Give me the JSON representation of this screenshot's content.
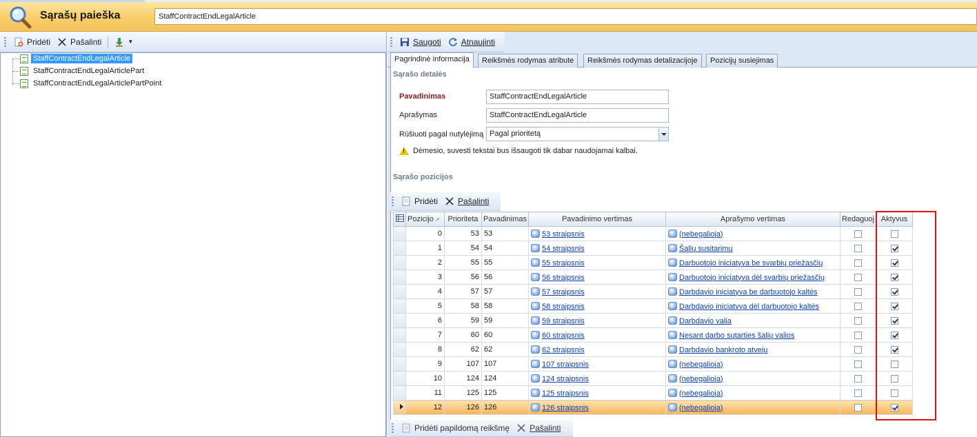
{
  "header": {
    "title": "Sąrašų paieška",
    "search_value": "StaffContractEndLegalArticle"
  },
  "left_toolbar": {
    "add_label": "Pridėti",
    "remove_label": "Pašalinti",
    "import_icon": "download-arrow-icon"
  },
  "tree": {
    "items": [
      {
        "label": "StaffContractEndLegalArticle",
        "selected": true
      },
      {
        "label": "StaffContractEndLegalArticlePart",
        "selected": false
      },
      {
        "label": "StaffContractEndLegalArticlePartPoint",
        "selected": false
      }
    ]
  },
  "right_toolbar": {
    "save_label": "Saugoti",
    "refresh_label": "Atnaujinti"
  },
  "tabs": [
    {
      "label": "Pagrindinė informacija",
      "active": true
    },
    {
      "label": "Reikšmės rodymas atribute",
      "active": false
    },
    {
      "label": "Reikšmės rodymas detalizacijoje",
      "active": false
    },
    {
      "label": "Pozicijų susiejimas",
      "active": false
    }
  ],
  "details": {
    "section_title": "Sąrašo detalės",
    "name_label": "Pavadinimas",
    "name_value": "StaffContractEndLegalArticle",
    "description_label": "Aprašymas",
    "description_value": "StaffContractEndLegalArticle",
    "sort_label": "Rūšiuoti pagal nutylėjimą",
    "sort_value": "Pagal prioritetą",
    "warning": "Dėmesio, suvesti tekstai bus išsaugoti tik dabar naudojamai kalbai."
  },
  "positions": {
    "section_title": "Sąrašo pozicijos",
    "add_label": "Pridėti",
    "remove_label": "Pašalinti",
    "columns": [
      "Pozicijo",
      "Prioriteta",
      "Pavadinimas",
      "Pavadinimo vertimas",
      "Aprašymo vertimas",
      "Redaguoj",
      "Aktyvus"
    ],
    "sort_indicator": "↗",
    "rows": [
      {
        "pos": "0",
        "prio": "53",
        "name": "53",
        "name_tr": "53 straipsnis",
        "desc_tr": "(nebegalioja)",
        "edit": false,
        "active": false
      },
      {
        "pos": "1",
        "prio": "54",
        "name": "54",
        "name_tr": "54 straipsnis",
        "desc_tr": "Šalių susitarimu",
        "edit": false,
        "active": true
      },
      {
        "pos": "2",
        "prio": "55",
        "name": "55",
        "name_tr": "55 straipsnis",
        "desc_tr": "Darbuotojo iniciatyva be svarbių priežasčių",
        "edit": false,
        "active": true
      },
      {
        "pos": "3",
        "prio": "56",
        "name": "56",
        "name_tr": "56 straipsnis",
        "desc_tr": "Darbuotojo iniciatyva dėl svarbių priežasčių",
        "edit": false,
        "active": true
      },
      {
        "pos": "4",
        "prio": "57",
        "name": "57",
        "name_tr": "57 straipsnis",
        "desc_tr": "Darbdavio iniciatyva be darbuotojo kaltės",
        "edit": false,
        "active": true
      },
      {
        "pos": "5",
        "prio": "58",
        "name": "58",
        "name_tr": "58 straipsnis",
        "desc_tr": "Darbdavio iniciatyva dėl darbuotojo kaltės",
        "edit": false,
        "active": true
      },
      {
        "pos": "6",
        "prio": "59",
        "name": "59",
        "name_tr": "59 straipsnis",
        "desc_tr": "Darbdavio valia",
        "edit": false,
        "active": true
      },
      {
        "pos": "7",
        "prio": "60",
        "name": "60",
        "name_tr": "60 straipsnis",
        "desc_tr": "Nesant darbo sutarties šalių valios",
        "edit": false,
        "active": true
      },
      {
        "pos": "8",
        "prio": "62",
        "name": "62",
        "name_tr": "62 straipsnis",
        "desc_tr": "Darbdavio bankroto atveju",
        "edit": false,
        "active": true
      },
      {
        "pos": "9",
        "prio": "107",
        "name": "107",
        "name_tr": "107 straipsnis",
        "desc_tr": "(nebegalioja)",
        "edit": false,
        "active": false
      },
      {
        "pos": "10",
        "prio": "124",
        "name": "124",
        "name_tr": "124 straipsnis",
        "desc_tr": "(nebegalioja)",
        "edit": false,
        "active": false
      },
      {
        "pos": "11",
        "prio": "125",
        "name": "125",
        "name_tr": "125 straipsnis",
        "desc_tr": "(nebegalioja)",
        "edit": false,
        "active": false
      },
      {
        "pos": "12",
        "prio": "126",
        "name": "126",
        "name_tr": "126 straipsnis",
        "desc_tr": "(nebegalioja)",
        "edit": false,
        "active": true,
        "current": true
      }
    ]
  },
  "bottom_toolbar": {
    "add_extra_label": "Pridėti papildomą reikšmę",
    "remove_label": "Pašalinti"
  },
  "colors": {
    "header_bg": "#f8cf6a",
    "selection": "#3399ff",
    "current_row": "#f7b45a",
    "link": "#0b3fb5",
    "highlight_box": "#e01010"
  }
}
